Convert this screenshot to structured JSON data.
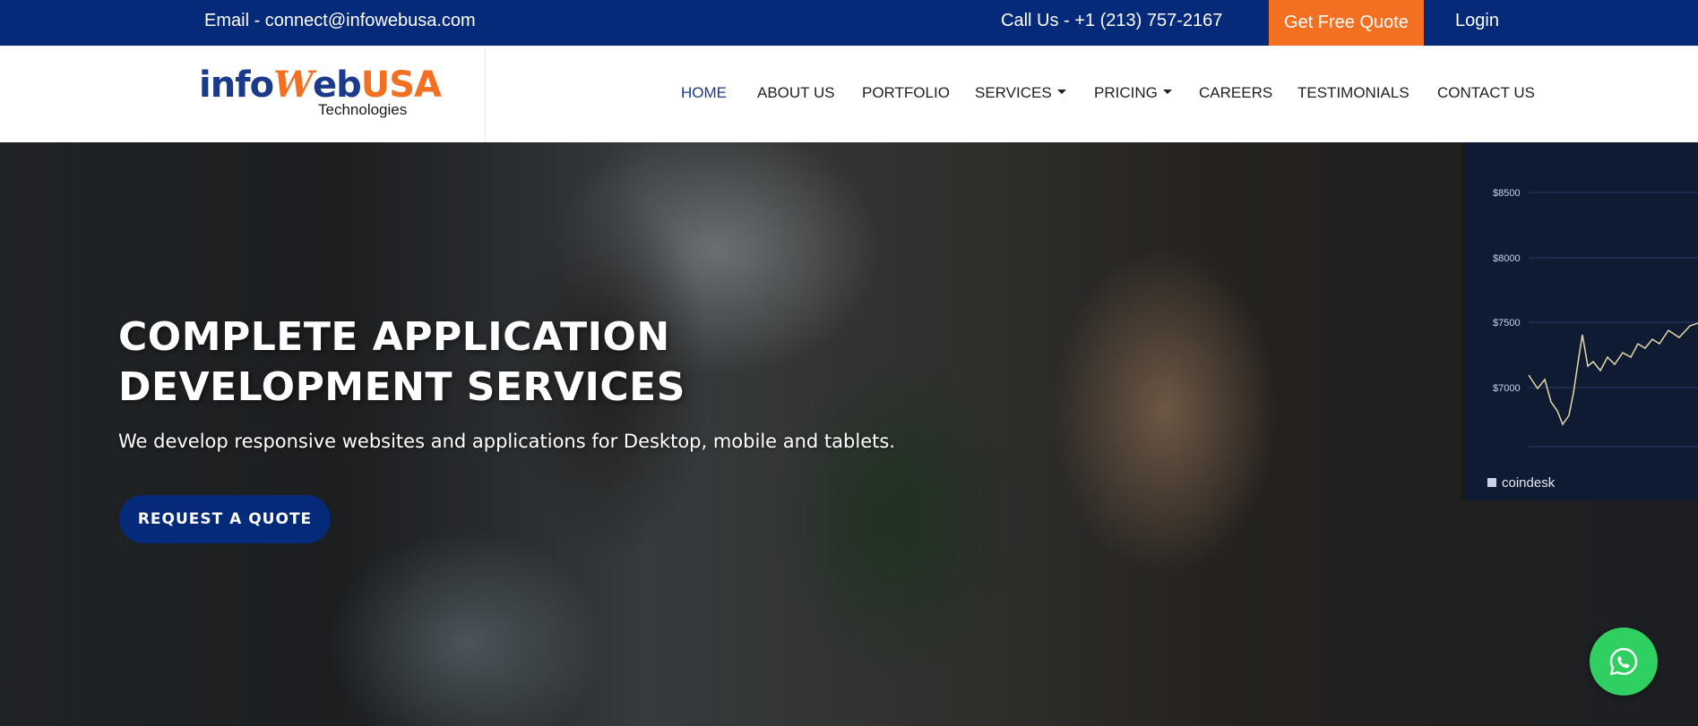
{
  "topbar": {
    "email": "Email - connect@infowebusa.com",
    "phone": "Call Us - +1 (213) 757-2167",
    "quote_button": "Get Free Quote",
    "login": "Login"
  },
  "logo": {
    "part1": "info",
    "part2": "W",
    "part3": "eb",
    "part4": "USA",
    "tagline": "Technologies"
  },
  "nav": {
    "items": [
      {
        "label": "HOME",
        "active": true
      },
      {
        "label": "ABOUT US"
      },
      {
        "label": "PORTFOLIO"
      },
      {
        "label": "SERVICES",
        "dropdown": true
      },
      {
        "label": "PRICING",
        "dropdown": true
      },
      {
        "label": "CAREERS"
      },
      {
        "label": "TESTIMONIALS"
      },
      {
        "label": "CONTACT US"
      }
    ]
  },
  "hero": {
    "title_line1": "COMPLETE APPLICATION",
    "title_line2": "DEVELOPMENT SERVICES",
    "subtitle": "We develop responsive websites and applications for Desktop, mobile and tablets.",
    "button": "REQUEST A QUOTE"
  },
  "monitor": {
    "labels": [
      "$8500",
      "$8000",
      "$7500",
      "$7000"
    ],
    "brand": "coindesk"
  },
  "colors": {
    "primary": "#062a7a",
    "accent": "#f36f21",
    "whatsapp": "#2fcf62"
  },
  "icons": {
    "whatsapp": "whatsapp-icon",
    "caret": "caret-down-icon"
  }
}
